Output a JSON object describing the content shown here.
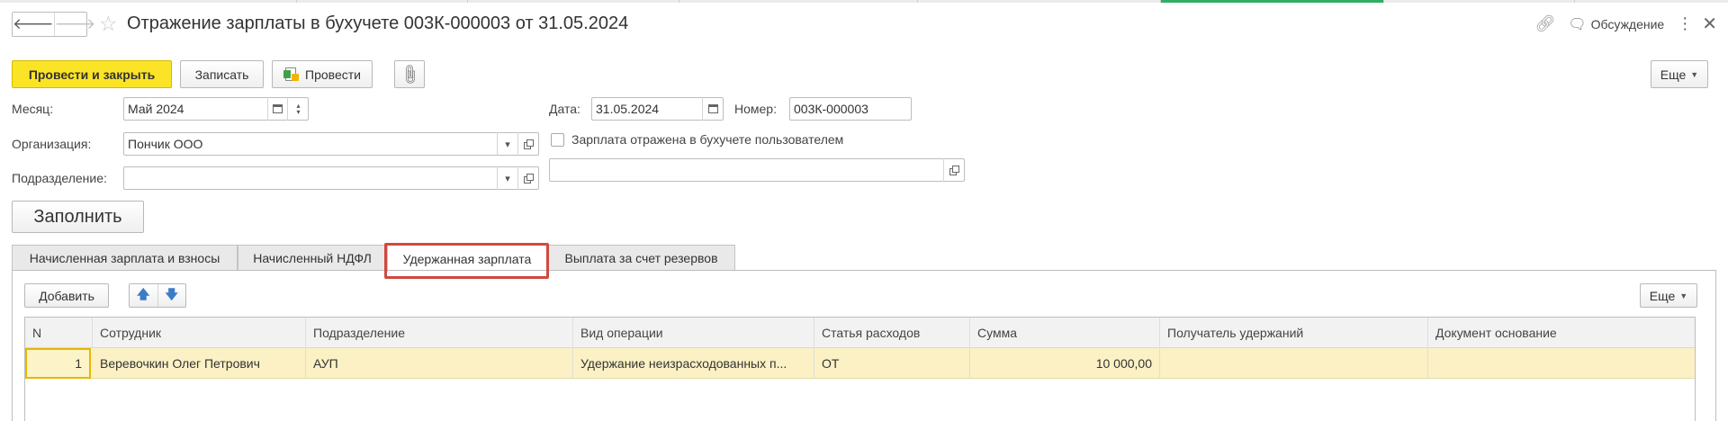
{
  "header": {
    "title": "Отражение зарплаты в бухучете 003К-000003 от 31.05.2024",
    "back_label": "🡐",
    "forward_label": "🡒",
    "favorite_icon": "star-icon",
    "discussion_label": "Обсуждение"
  },
  "toolbar": {
    "post_close_label": "Провести и закрыть",
    "save_label": "Записать",
    "post_label": "Провести",
    "more_label": "Еще"
  },
  "form": {
    "month_label": "Месяц:",
    "month_value": "Май 2024",
    "org_label": "Организация:",
    "org_value": "Пончик ООО",
    "dept_label": "Подразделение:",
    "dept_value": "",
    "date_label": "Дата:",
    "date_value": "31.05.2024",
    "number_label": "Номер:",
    "number_value": "003К-000003",
    "reflected_label": "Зарплата отражена в бухучете пользователем",
    "reflected_checked": false,
    "user_value": "",
    "fill_label": "Заполнить"
  },
  "tabs": [
    {
      "label": "Начисленная зарплата и взносы",
      "active": false
    },
    {
      "label": "Начисленный НДФЛ",
      "active": false
    },
    {
      "label": "Удержанная зарплата",
      "active": true
    },
    {
      "label": "Выплата за счет резервов",
      "active": false
    }
  ],
  "table_toolbar": {
    "add_label": "Добавить",
    "move_up_icon": "arrow-up-icon",
    "move_down_icon": "arrow-down-icon",
    "more_label": "Еще"
  },
  "table": {
    "columns": [
      "N",
      "Сотрудник",
      "Подразделение",
      "Вид операции",
      "Статья расходов",
      "Сумма",
      "Получатель удержаний",
      "Документ основание"
    ],
    "rows": [
      {
        "n": "1",
        "employee": "Веревочкин Олег Петрович",
        "department": "АУП",
        "operation": "Удержание неизрасходованных п...",
        "expense_item": "ОТ",
        "amount": "10 000,00",
        "recipient": "",
        "basis_doc": ""
      }
    ]
  },
  "colors": {
    "primary_button": "#fbe326",
    "active_row": "#fbf1c4",
    "tab_highlight": "#d0493f",
    "open_window_tab": "#2fae66"
  }
}
